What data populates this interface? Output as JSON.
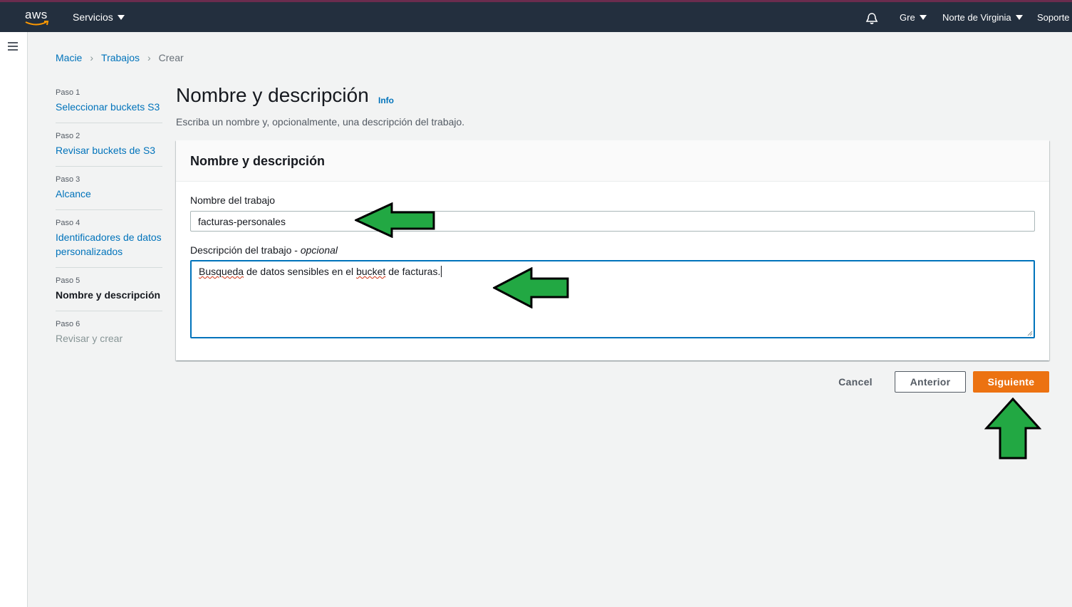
{
  "topbar": {
    "logo_text": "aws",
    "services_label": "Servicios",
    "user_label": "Gre",
    "region_label": "Norte de Virginia",
    "support_label": "Soporte"
  },
  "breadcrumb": {
    "items": [
      "Macie",
      "Trabajos"
    ],
    "current": "Crear"
  },
  "steps": [
    {
      "num": "Paso 1",
      "name": "Seleccionar buckets S3"
    },
    {
      "num": "Paso 2",
      "name": "Revisar buckets de S3"
    },
    {
      "num": "Paso 3",
      "name": "Alcance"
    },
    {
      "num": "Paso 4",
      "name": "Identificadores de datos personalizados"
    },
    {
      "num": "Paso 5",
      "name": "Nombre y descripción"
    },
    {
      "num": "Paso 6",
      "name": "Revisar y crear"
    }
  ],
  "page": {
    "title": "Nombre y descripción",
    "info": "Info",
    "description": "Escriba un nombre y, opcionalmente, una descripción del trabajo."
  },
  "panel": {
    "header": "Nombre y descripción",
    "name_label": "Nombre del trabajo",
    "name_value": "facturas-personales",
    "desc_label": "Descripción del trabajo - ",
    "desc_optional": "opcional",
    "desc_value_word1": "Busqueda",
    "desc_value_mid": " de datos sensibles en el ",
    "desc_value_word2": "bucket",
    "desc_value_end": " de facturas."
  },
  "actions": {
    "cancel": "Cancel",
    "previous": "Anterior",
    "next": "Siguiente"
  },
  "colors": {
    "topbar": "#232f3e",
    "link": "#0073bb",
    "primary_button": "#ec7211",
    "annotation_arrow": "#22a843"
  }
}
